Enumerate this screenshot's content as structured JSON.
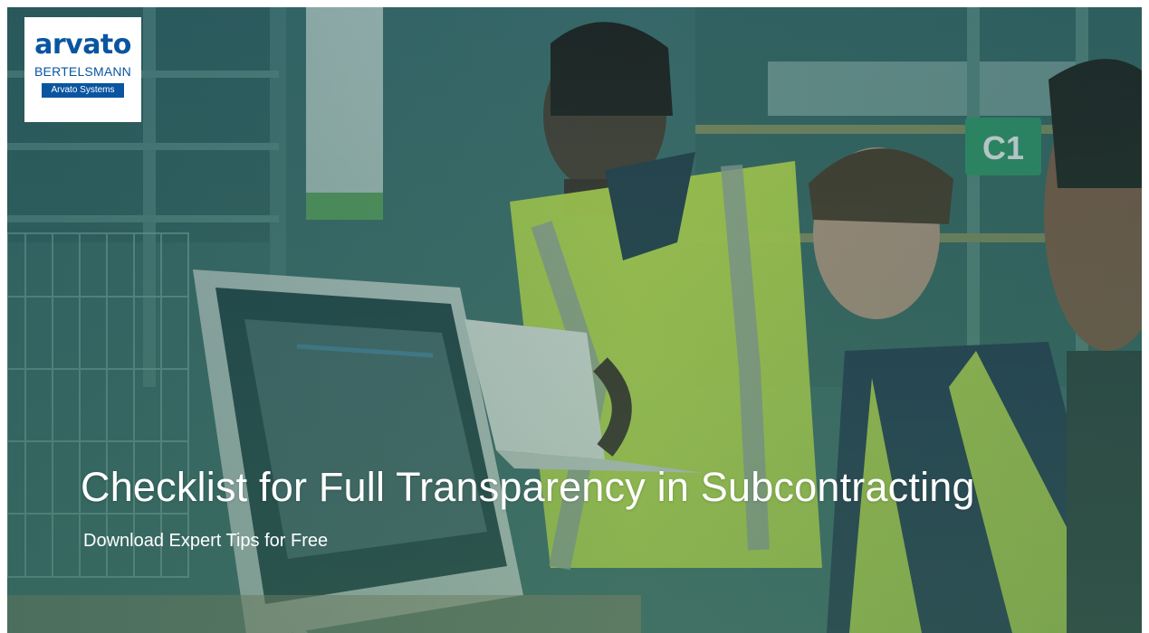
{
  "brand": {
    "wordmark": "arvato",
    "parent": "BERTELSMANN",
    "division": "Arvato Systems",
    "color": "#0a55a0"
  },
  "hero": {
    "headline": "Checklist for Full Transparency in Subcontracting",
    "subheadline": "Download Expert Tips for Free",
    "overlay_color": "#3c6a6a",
    "vest_color": "#c8e84a"
  },
  "scene": {
    "shelf_sign_text": "C1"
  }
}
